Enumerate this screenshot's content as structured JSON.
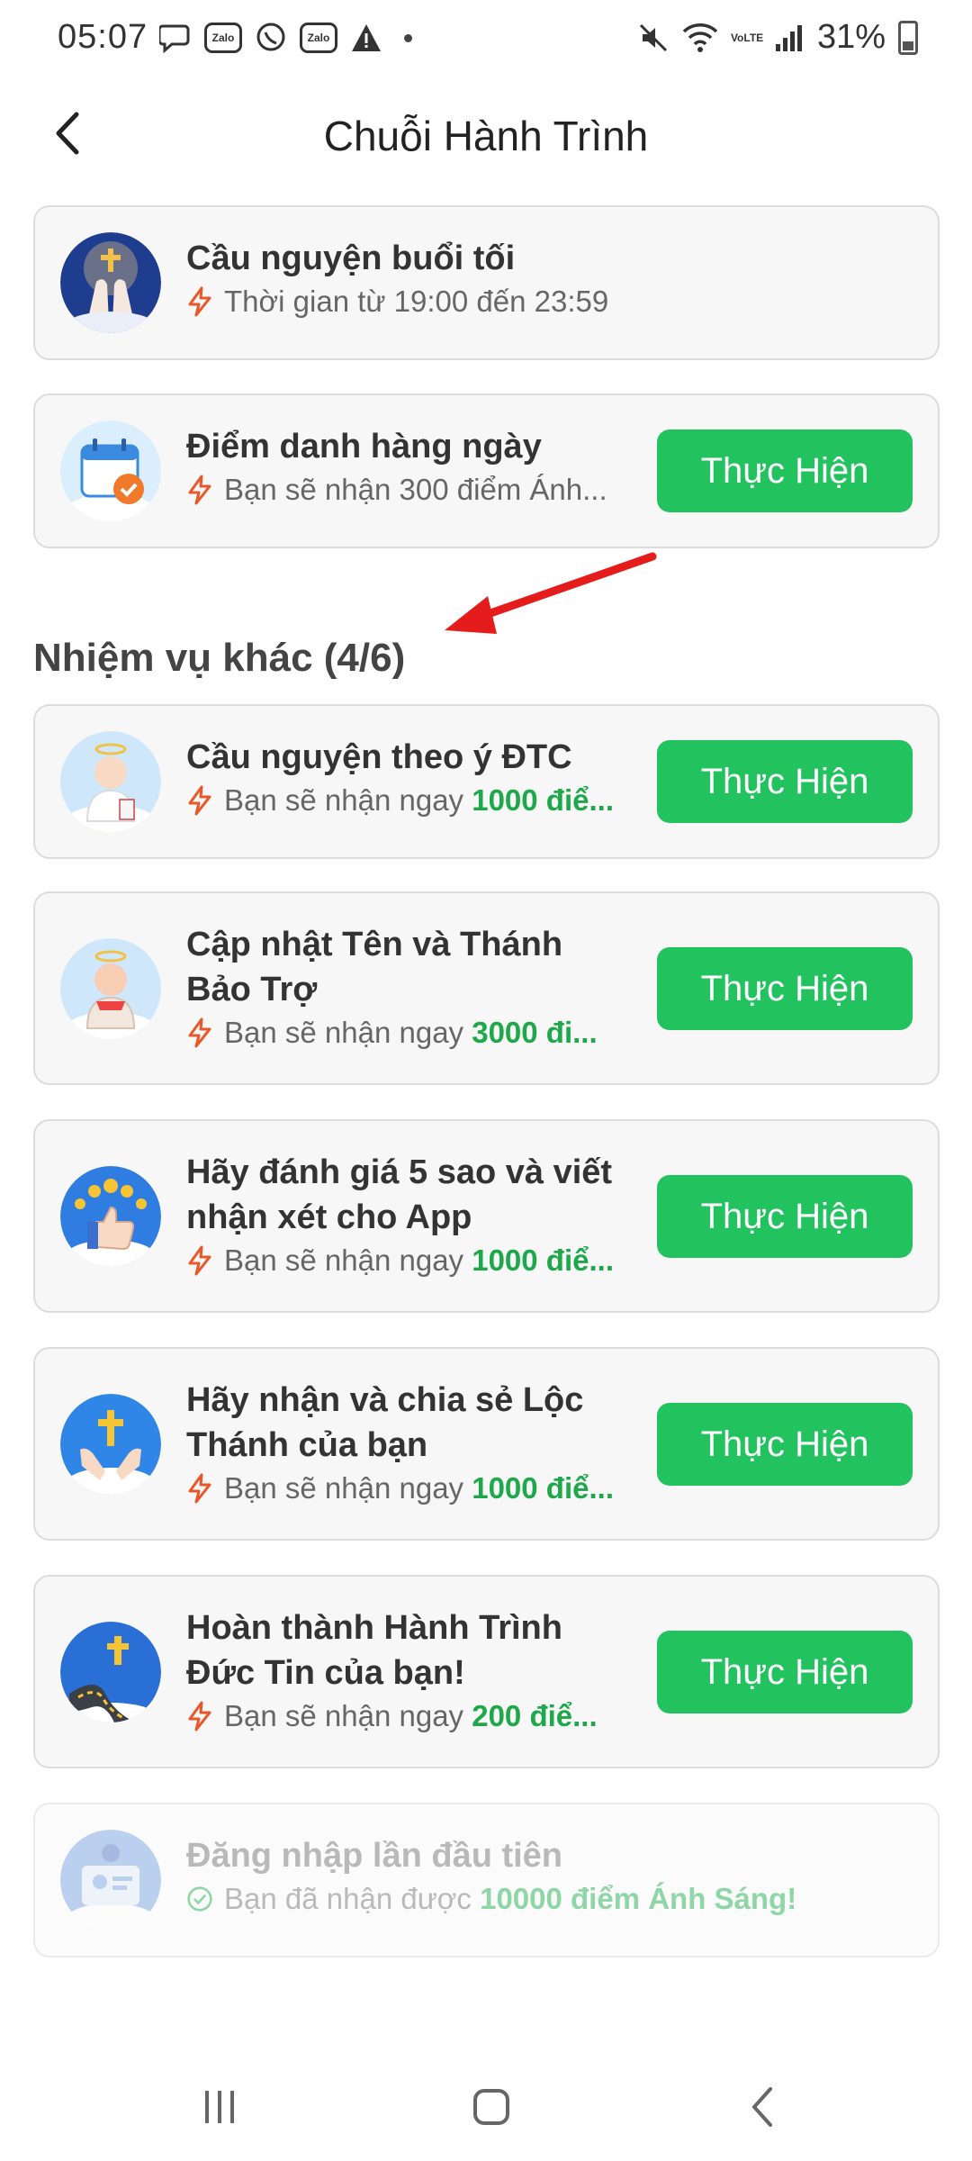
{
  "status_bar": {
    "time": "05:07",
    "battery": "31%",
    "notification_icons": [
      "chat-icon",
      "zalo-icon",
      "viber-icon",
      "zalo-icon",
      "warning-icon"
    ],
    "zalo_label": "Zalo",
    "volte_label": "VoLTE"
  },
  "header": {
    "title": "Chuỗi Hành Trình"
  },
  "colors": {
    "accent_green": "#22c35e",
    "highlight_green": "#1ea84a",
    "bolt_orange": "#e8582a",
    "arrow_red": "#e51c1c"
  },
  "daily_tasks": [
    {
      "title": "Cầu nguyện buổi tối",
      "subtitle": "Thời gian từ 19:00 đến 23:59",
      "icon": "praying-hands-icon"
    },
    {
      "title": "Điểm danh hàng ngày",
      "subtitle": "Bạn sẽ nhận 300 điểm Ánh...",
      "button": "Thực Hiện",
      "icon": "calendar-check-icon"
    }
  ],
  "other_tasks": {
    "heading": "Nhiệm vụ khác (4/6)",
    "items": [
      {
        "title": "Cầu nguyện theo ý ĐTC",
        "subtitle_prefix": "Bạn sẽ nhận ngay ",
        "subtitle_highlight": "1000 điể...",
        "button": "Thực Hiện",
        "icon": "pope-icon"
      },
      {
        "title_line1": "Cập nhật Tên và Thánh",
        "title_line2": "Bảo Trợ",
        "subtitle_prefix": "Bạn sẽ nhận ngay ",
        "subtitle_highlight": "3000 đi...",
        "button": "Thực Hiện",
        "icon": "saint-icon"
      },
      {
        "title_line1": "Hãy đánh giá 5 sao và viết",
        "title_line2": "nhận xét cho App",
        "subtitle_prefix": "Bạn sẽ nhận ngay ",
        "subtitle_highlight": "1000 điể...",
        "button": "Thực Hiện",
        "icon": "five-stars-thumbs-up-icon"
      },
      {
        "title_line1": "Hãy nhận và chia sẻ Lộc",
        "title_line2": "Thánh của bạn",
        "subtitle_prefix": "Bạn sẽ nhận ngay ",
        "subtitle_highlight": "1000 điể...",
        "button": "Thực Hiện",
        "icon": "hands-cross-icon"
      },
      {
        "title_line1": "Hoàn thành Hành Trình",
        "title_line2": "Đức Tin của bạn!",
        "subtitle_prefix": "Bạn sẽ nhận ngay ",
        "subtitle_highlight": "200 điể...",
        "button": "Thực Hiện",
        "icon": "road-cross-icon"
      },
      {
        "title": "Đăng nhập lần đầu tiên",
        "subtitle_prefix": "Bạn đã nhận được ",
        "subtitle_highlight": "10000 điểm Ánh Sáng!",
        "status": "completed",
        "icon": "login-card-icon"
      }
    ]
  },
  "nav_bar": {
    "items": [
      "recent-apps-icon",
      "home-icon",
      "back-icon"
    ]
  }
}
